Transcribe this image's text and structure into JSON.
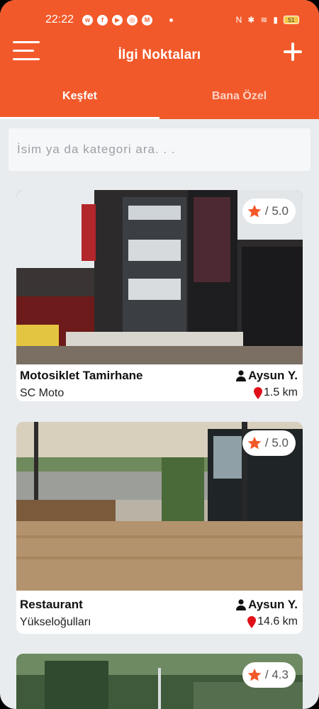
{
  "status_bar": {
    "time": "22:22",
    "battery": "51",
    "app_icons": [
      "whatsapp-icon",
      "facebook-icon",
      "youtube-icon",
      "instagram-icon",
      "gmail-icon"
    ]
  },
  "header": {
    "title": "İlgi Noktaları",
    "color": "#f2592a"
  },
  "tabs": [
    {
      "label": "Keşfet",
      "active": true
    },
    {
      "label": "Bana Özel",
      "active": false
    }
  ],
  "search": {
    "placeholder": "İsim ya da kategori ara. . ."
  },
  "places": [
    {
      "category": "Motosiklet Tamirhane",
      "name": "SC Moto",
      "owner": "Aysun Y.",
      "distance": "1.5 km",
      "rating": "/ 5.0"
    },
    {
      "category": "Restaurant",
      "name": "Yükseloğulları",
      "owner": "Aysun Y.",
      "distance": "14.6 km",
      "rating": "/ 5.0"
    },
    {
      "category": "",
      "name": "",
      "owner": "",
      "distance": "",
      "rating": "/ 4.3"
    }
  ],
  "colors": {
    "star": "#f2592a",
    "pin": "#e0101a",
    "background": "#e8ecef"
  }
}
